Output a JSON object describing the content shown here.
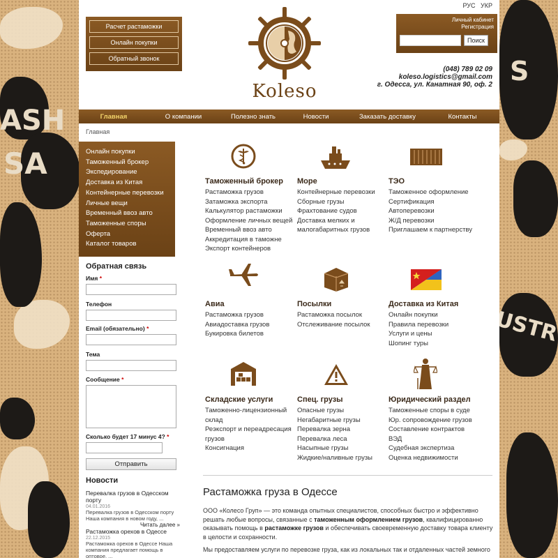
{
  "header": {
    "lang": [
      "РУС",
      "УКР"
    ],
    "quick_buttons": [
      "Расчет растаможки",
      "Онлайн покупки",
      "Обратный звонок"
    ],
    "logo_text": "Koleso",
    "login_links": [
      "Личный кабинет",
      "Регистрация"
    ],
    "search_button": "Поиск",
    "phone": "(048) 789 02 09",
    "email": "koleso.logistics@gmail.com",
    "address": "г. Одесса, ул. Канатная 90, оф. 2"
  },
  "nav": [
    "Главная",
    "О компании",
    "Полезно знать",
    "Новости",
    "Заказать доставку",
    "Контакты"
  ],
  "breadcrumb": "Главная",
  "side_menu": [
    "Онлайн покупки",
    "Таможенный брокер",
    "Экспедирование",
    "Доставка из Китая",
    "Контейнерные перевозки",
    "Личные вещи",
    "Временный ввоз авто",
    "Таможенные споры",
    "Оферта",
    "Каталог товаров"
  ],
  "feedback": {
    "title": "Обратная связь",
    "name_label": "Имя",
    "phone_label": "Телефон",
    "email_label": "Email (обязательно)",
    "subject_label": "Тема",
    "message_label": "Сообщение",
    "captcha_label": "Сколько будет 17 минус 4?",
    "required_mark": "*",
    "submit": "Отправить"
  },
  "news": {
    "title": "Новости",
    "items": [
      {
        "head": "Перевалка грузов в Одесском порту",
        "date": "04.01.2016",
        "text": "Перевалка грузов в Одесском порту Наша компания в новом году, ...",
        "more": "Читать далее »"
      },
      {
        "head": "Растаможка орехов в Одессе",
        "date": "22.12.2015",
        "text": "Растаможка орехов в Одессе Наша компания предлагает помощь в оптовое, ..."
      }
    ]
  },
  "categories": [
    {
      "title": "Таможенный брокер",
      "icon": "caduceus-icon",
      "links": [
        "Растаможка грузов",
        "Затаможка экспорта",
        "Калькулятор растаможки",
        "Оформление личных вещей",
        "Временный ввоз авто",
        "Аккредитация в таможне",
        "Экспорт контейнеров"
      ]
    },
    {
      "title": "Море",
      "icon": "ship-icon",
      "links": [
        "Контейнерные перевозки",
        "Сборные грузы",
        "Фрахтование судов",
        "Доставка мелких и",
        "малогабаритных грузов"
      ]
    },
    {
      "title": "ТЭО",
      "icon": "container-icon",
      "links": [
        "Таможенное оформление",
        "Сертификация",
        "Автоперевозки",
        "Ж/Д перевозки",
        "Приглашаем к партнерству"
      ]
    },
    {
      "title": "Авиа",
      "icon": "airplane-icon",
      "links": [
        "Растаможка грузов",
        "Авиадоставка грузов",
        "Букировка билетов"
      ]
    },
    {
      "title": "Посылки",
      "icon": "parcel-icon",
      "links": [
        "Растаможка посылок",
        "Отслеживание посылок"
      ]
    },
    {
      "title": "Доставка из Китая",
      "icon": "china-ukraine-flag-icon",
      "links": [
        "Онлайн покупки",
        "Правила перевозки",
        "Услуги и цены",
        "Шопинг туры"
      ]
    },
    {
      "title": "Складские услуги",
      "icon": "warehouse-icon",
      "links": [
        "Таможенно-лицензионный",
        "склад",
        "Реэкспорт и переадресация",
        "грузов",
        "Консигнация"
      ]
    },
    {
      "title": "Спец. грузы",
      "icon": "warning-icon",
      "links": [
        "Опасные грузы",
        "Негабаритные грузы",
        "Перевалка зерна",
        "Перевалка леса",
        "Насыпные грузы",
        "Жидкие/наливные грузы"
      ]
    },
    {
      "title": "Юридический раздел",
      "icon": "justice-icon",
      "links": [
        "Таможенные споры в суде",
        "Юр. сопровождение грузов",
        "Составление контрактов",
        "ВЭД",
        "Судебная экспертиза",
        "Оценка недвижимости"
      ]
    }
  ],
  "article": {
    "title": "Растаможка груза в Одессе",
    "p1_a": "ООО «Колесо Груп» — это команда опытных специалистов, способных быстро и эффективно решать любые вопросы, связанные с ",
    "p1_b": "таможенным оформлением грузов",
    "p1_c": ", квалифицированно оказывать помощь в ",
    "p1_d": "растаможке грузов",
    "p1_e": " и обеспечивать своевременную доставку товара клиенту в целости и сохранности.",
    "p2": "Мы предоставляем услуги по перевозке груза, как из локальных так и отдаленных частей земного"
  },
  "colors": {
    "brand_brown": "#7a4c1c",
    "nav_active": "#f3d36a"
  }
}
